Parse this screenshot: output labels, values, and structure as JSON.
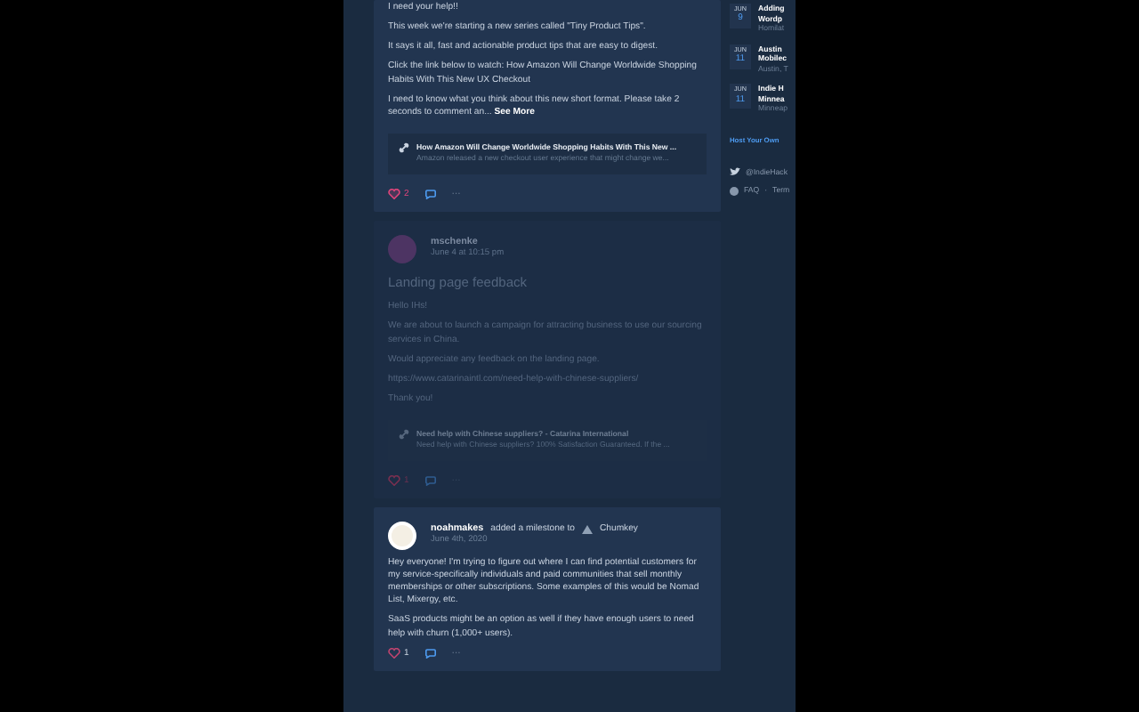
{
  "posts": [
    {
      "kind": "cut",
      "dimmed": false,
      "title_line": "I need your help!!",
      "paragraphs": [
        "This week we're starting a new series called \"Tiny Product Tips\".",
        "It says it all, fast and actionable product tips that are easy to digest.",
        "Click the link below to watch: How Amazon Will Change Worldwide Shopping Habits With This New UX Checkout",
        "I need to know what you think about this new short format. Please take 2 seconds to comment an..."
      ],
      "see_more": "See More",
      "link": {
        "title": "How Amazon Will Change Worldwide Shopping Habits With This New ...",
        "description": "Amazon released a new checkout user experience that might change we..."
      },
      "likes": "2",
      "liked": true,
      "more": "···"
    },
    {
      "kind": "full",
      "dimmed": true,
      "author": "mschenke",
      "date": "June 4 at 10:15 pm",
      "title": "Landing page feedback",
      "paragraphs": [
        "Hello IHs!",
        "We are about to launch a campaign for attracting business to use our sourcing services in China.",
        "Would appreciate any feedback on the landing page.",
        "https://www.catarinaintl.com/need-help-with-chinese-suppliers/",
        "Thank you!"
      ],
      "link": {
        "title": "Need help with Chinese suppliers? - Catarina International",
        "description": "Need help with Chinese suppliers? 100% Satisfaction Guaranteed. If the ..."
      },
      "likes": "1",
      "liked": false,
      "more": "···"
    },
    {
      "kind": "milestone",
      "dimmed": false,
      "author": "noahmakes",
      "action": "added a milestone to",
      "product": "Chumkey",
      "date": "June 4th, 2020",
      "paragraphs": [
        "Hey everyone! I'm trying to figure out where I can find potential customers for my service-specifically individuals and paid communities that sell monthly memberships or other subscriptions. Some examples of this would be Nomad List, Mixergy, etc.",
        "SaaS products might be an option as well if they have enough users to need help with churn (1,000+ users)."
      ],
      "likes": "1",
      "liked": false,
      "more": "···"
    }
  ],
  "sidebar": {
    "events": [
      {
        "month": "JUN",
        "day": "9",
        "title": [
          "Adding",
          "Wordp"
        ],
        "place": "Homilat"
      },
      {
        "month": "JUN",
        "day": "11",
        "title": [
          "Austin",
          "Mobilec"
        ],
        "place": "Austin, T"
      },
      {
        "month": "JUN",
        "day": "11",
        "title": [
          "Indie H",
          "Minnea"
        ],
        "place": "Minneap"
      }
    ],
    "host_link": "Host Your Own",
    "twitter": "@IndieHack",
    "faq": "FAQ",
    "separator": "·",
    "terms": "Term"
  }
}
